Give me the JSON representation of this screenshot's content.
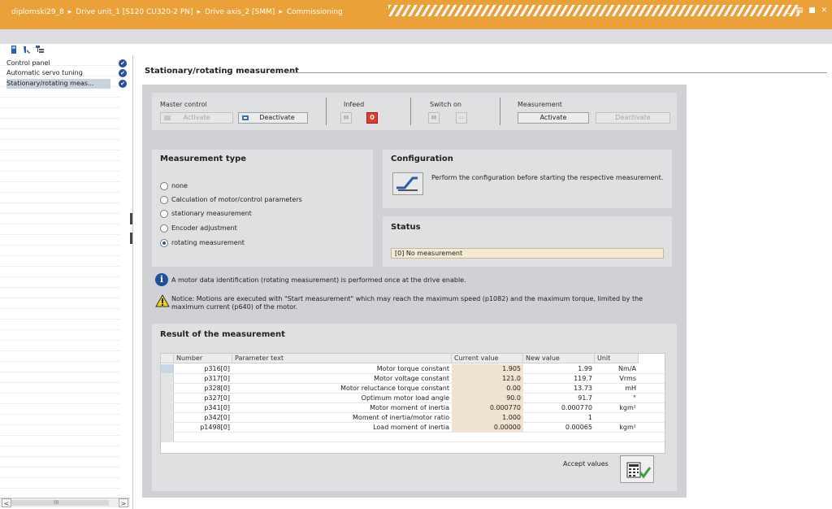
{
  "title_bar": {
    "crumbs": [
      "diplomski29_8",
      "Drive unit_1 [S120 CU320-2 PN]",
      "Drive axis_2 [SMM]",
      "Commissioning"
    ],
    "separator": "▸",
    "window_controls": "_ ▤ ■ ✕"
  },
  "toolbar": {
    "icons": [
      "device-icon",
      "tool-icon",
      "tree-icon"
    ]
  },
  "nav": {
    "items": [
      {
        "label": "Control panel",
        "selected": false
      },
      {
        "label": "Automatic servo tuning",
        "selected": false
      },
      {
        "label": "Stationary/rotating meas...",
        "selected": true
      }
    ],
    "check_glyph": "✔",
    "scroll_left": "<",
    "scroll_right": ">",
    "scroll_mid": "III"
  },
  "main": {
    "section_title": "Stationary/rotating measurement",
    "master_control": {
      "label": "Master control",
      "activate": "Activate",
      "deactivate": "Deactivate"
    },
    "infeed": {
      "label": "Infeed",
      "indicator": "0"
    },
    "switch_on": {
      "label": "Switch on"
    },
    "measurement": {
      "label": "Measurement",
      "activate": "Activate",
      "deactivate": "Deactivate"
    },
    "measurement_type": {
      "header": "Measurement type",
      "options": [
        {
          "label": "none",
          "selected": false
        },
        {
          "label": "Calculation of motor/control parameters",
          "selected": false
        },
        {
          "label": "stationary measurement",
          "selected": false
        },
        {
          "label": "Encoder adjustment",
          "selected": false
        },
        {
          "label": "rotating measurement",
          "selected": true
        }
      ]
    },
    "configuration": {
      "header": "Configuration",
      "text": "Perform the configuration before starting the respective measurement."
    },
    "status": {
      "header": "Status",
      "value": "[0] No measurement"
    },
    "info_message": "A motor data identification (rotating measurement) is performed once at the drive enable.",
    "notice_message": "Notice: Motions are executed with \"Start measurement\" which may reach the maximum speed (p1082) and the maximum torque, limited by the maximum current (p640) of the motor.",
    "result": {
      "header": "Result of the measurement",
      "columns": [
        "Number",
        "Parameter text",
        "Current value",
        "New value",
        "Unit"
      ],
      "rows": [
        {
          "number": "p316[0]",
          "text": "Motor torque constant",
          "current": "1.905",
          "new": "1.99",
          "unit": "Nm/A"
        },
        {
          "number": "p317[0]",
          "text": "Motor voltage constant",
          "current": "121.0",
          "new": "119.7",
          "unit": "Vrms"
        },
        {
          "number": "p328[0]",
          "text": "Motor reluctance torque constant",
          "current": "0.00",
          "new": "13.73",
          "unit": "mH"
        },
        {
          "number": "p327[0]",
          "text": "Optimum motor load angle",
          "current": "90.0",
          "new": "91.7",
          "unit": "°"
        },
        {
          "number": "p341[0]",
          "text": "Motor moment of inertia",
          "current": "0.000770",
          "new": "0.000770",
          "unit": "kgm²"
        },
        {
          "number": "p342[0]",
          "text": "Moment of inertia/motor ratio",
          "current": "1.000",
          "new": "1",
          "unit": ""
        },
        {
          "number": "p1498[0]",
          "text": "Load moment of inertia",
          "current": "0.00000",
          "new": "0.00065",
          "unit": "kgm²"
        }
      ],
      "accept_label": "Accept values"
    }
  },
  "colors": {
    "title_bar": "#eba13a",
    "panel": "#dfe0e2",
    "outer_panel": "#cfd1d4",
    "accent_blue": "#1e4fa0",
    "infeed_red": "#e23a2e",
    "current_value_bg": "#efe3cd"
  }
}
